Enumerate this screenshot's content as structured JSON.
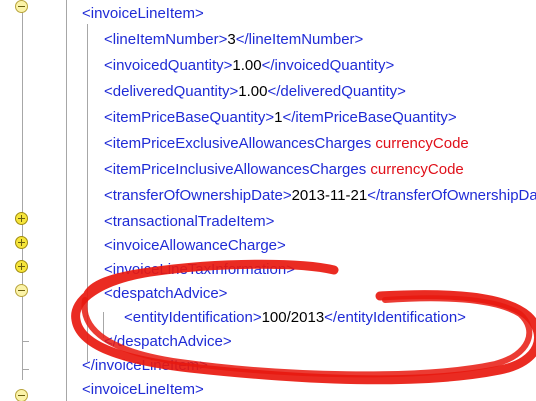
{
  "editor": {
    "lines": [
      {
        "open": "invoiceLineItem",
        "text": "",
        "close": "",
        "attr": ""
      },
      {
        "open": "lineItemNumber",
        "text": "3",
        "close": "lineItemNumber",
        "attr": ""
      },
      {
        "open": "invoicedQuantity",
        "text": "1.00",
        "close": "invoicedQuantity",
        "attr": ""
      },
      {
        "open": "deliveredQuantity",
        "text": "1.00",
        "close": "deliveredQuantity",
        "attr": ""
      },
      {
        "open": "itemPriceBaseQuantity",
        "text": "1",
        "close": "itemPriceBaseQuantity",
        "attr": ""
      },
      {
        "open": "itemPriceExclusiveAllowancesCharges",
        "text": "",
        "close": "",
        "attr": "currencyCode"
      },
      {
        "open": "itemPriceInclusiveAllowancesCharges",
        "text": "",
        "close": "",
        "attr": "currencyCode"
      },
      {
        "open": "transferOfOwnershipDate",
        "text": "2013-11-21",
        "close": "transferOfOwnershipDate",
        "attr": ""
      },
      {
        "open": "transactionalTradeItem",
        "text": "",
        "close": "",
        "attr": ""
      },
      {
        "open": "invoiceAllowanceCharge",
        "text": "",
        "close": "",
        "attr": ""
      },
      {
        "open": "invoiceLineTaxInformation",
        "text": "",
        "close": "",
        "attr": ""
      },
      {
        "open": "despatchAdvice",
        "text": "",
        "close": "",
        "attr": ""
      },
      {
        "open": "entityIdentification",
        "text": "100/2013",
        "close": "entityIdentification",
        "attr": ""
      },
      {
        "open": "",
        "text": "",
        "close": "despatchAdvice",
        "attr": ""
      },
      {
        "open": "",
        "text": "",
        "close": "invoiceLineItem",
        "attr": ""
      },
      {
        "open": "invoiceLineItem",
        "text": "",
        "close": "",
        "attr": ""
      }
    ]
  },
  "annotation": {
    "stroke_color": "#e8190f"
  },
  "colors": {
    "tag": "#1f2bd6",
    "attribute": "#e0101a",
    "text": "#000000",
    "fold_collapsed": "#f6e53b",
    "fold_open": "#fbf3a8"
  }
}
